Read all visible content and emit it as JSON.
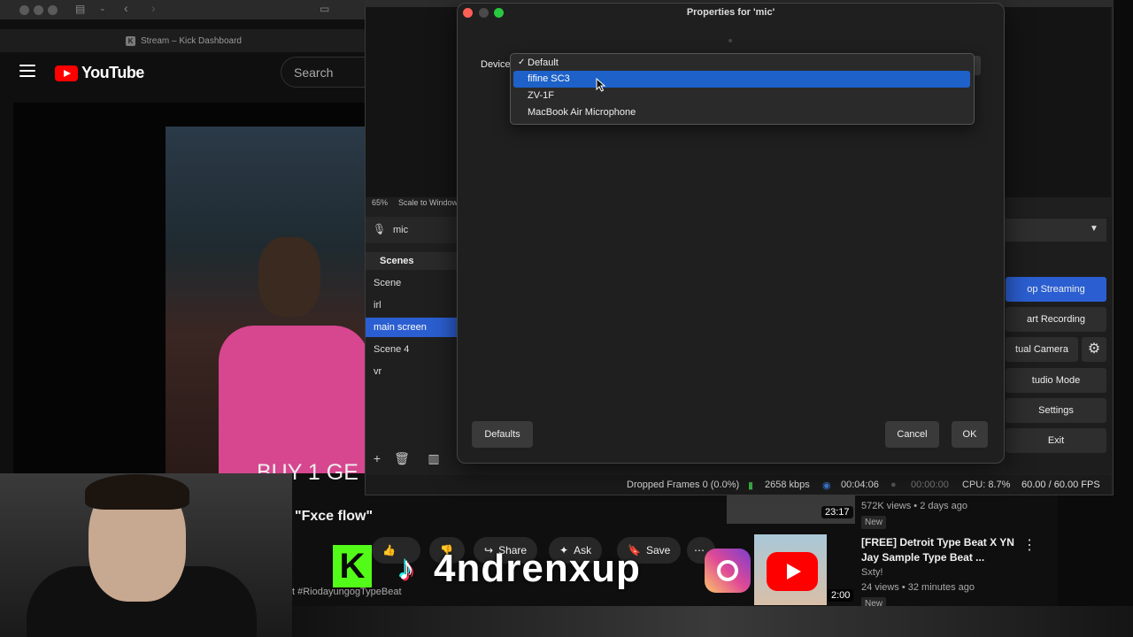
{
  "browser": {
    "tab_title": "Stream – Kick Dashboard",
    "tab_icon": "K",
    "youtube_logo": "YouTube",
    "search_placeholder": "Search",
    "video_caption": "BUY 1 GE",
    "video_title": "\"Fxce flow\"",
    "actions": {
      "share": "Share",
      "ask": "Ask",
      "save": "Save"
    },
    "hashtag": "t #RiodayungogTypeBeat"
  },
  "overlay": {
    "handle": "4ndrenxup",
    "kick_glyph": "K",
    "tiktok_glyph": "♪"
  },
  "sidebar_videos": [
    {
      "duration": "23:17",
      "meta": "572K views • 2 days ago",
      "badge": "New"
    },
    {
      "title": "[FREE] Detroit Type Beat X YN Jay Sample Type Beat ...",
      "channel": "Sxty!",
      "meta": "24 views • 32 minutes ago",
      "duration": "2:00",
      "badge": "New"
    }
  ],
  "obs": {
    "zoom": "65%",
    "scale_mode": "Scale to Window",
    "source_name": "mic",
    "scenes_header": "Scenes",
    "scenes": [
      "Scene",
      "irl",
      "main screen",
      "Scene 4",
      "vr"
    ],
    "active_scene": "main screen",
    "controls": {
      "stop_streaming": "op Streaming",
      "start_recording": "art Recording",
      "virtual_camera": "tual Camera",
      "studio_mode": "tudio Mode",
      "settings": "Settings",
      "exit": "Exit"
    },
    "status": {
      "dropped": "Dropped Frames 0 (0.0%)",
      "bitrate": "2658 kbps",
      "stream_time": "00:04:06",
      "rec_time": "00:00:00",
      "cpu": "CPU: 8.7%",
      "fps": "60.00 / 60.00 FPS"
    },
    "accent_color": "#2b5fd1"
  },
  "dialog": {
    "title": "Properties for 'mic'",
    "device_label": "Device",
    "options": [
      "Default",
      "fifine SC3",
      "ZV-1F",
      "MacBook Air Microphone"
    ],
    "checked_option": "Default",
    "highlighted_option": "fifine SC3",
    "defaults_button": "Defaults",
    "cancel_button": "Cancel",
    "ok_button": "OK"
  }
}
